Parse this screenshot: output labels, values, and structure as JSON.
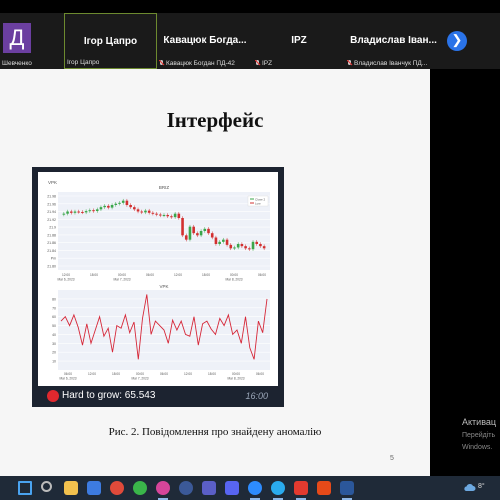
{
  "participants": [
    {
      "name": "Д",
      "label": "Шевченко",
      "muted": false
    },
    {
      "name": "Ігор Цапро",
      "label": "Ігор Цапро",
      "muted": false
    },
    {
      "name": "Кавацюк  Богда...",
      "label": "Кавацюк Богдан ПД-42",
      "muted": true
    },
    {
      "name": "IPZ",
      "label": "IPZ",
      "muted": true
    },
    {
      "name": "Владислав Іван...",
      "label": "Владислав Іванчук ПД...",
      "muted": true
    }
  ],
  "next_icon": "chevron-right-icon",
  "slide": {
    "title": "Інтерфейс",
    "caption": "Рис. 2. Повідомлення про знайдену аномалію",
    "page_number": "5"
  },
  "message": {
    "alert_text": "Hard to grow: 65.543",
    "time": "16:00",
    "dot_color": "#e0282e"
  },
  "chart_data": [
    {
      "type": "candlestick",
      "corner_label": "VPK",
      "title": "BRIZ",
      "legend": [
        "Close 2",
        "Low"
      ],
      "ylim": [
        21.8,
        21.98
      ],
      "y_ticks": [
        "21.98",
        "21.96",
        "21.94",
        "21.92",
        "21.9",
        "21.88",
        "21.86",
        "21.84",
        "Pm",
        "21.80"
      ],
      "x_ticks": [
        "12:00\nMar 6, 2023",
        "18:00",
        "00:00\nMar 7, 2023",
        "06:00",
        "12:00",
        "18:00",
        "00:00\nMar 8, 2023",
        "06:00"
      ],
      "closes": [
        21.93,
        21.935,
        21.932,
        21.935,
        21.934,
        21.933,
        21.936,
        21.938,
        21.936,
        21.94,
        21.945,
        21.948,
        21.944,
        21.95,
        21.953,
        21.955,
        21.96,
        21.95,
        21.945,
        21.94,
        21.935,
        21.933,
        21.937,
        21.932,
        21.93,
        21.928,
        21.926,
        21.927,
        21.924,
        21.922,
        21.93,
        21.92,
        21.88,
        21.87,
        21.9,
        21.885,
        21.88,
        21.89,
        21.895,
        21.885,
        21.875,
        21.86,
        21.865,
        21.87,
        21.858,
        21.85,
        21.852,
        21.86,
        21.855,
        21.85,
        21.848,
        21.865,
        21.86,
        21.855,
        21.85
      ]
    },
    {
      "type": "line",
      "corner_label": "VPK",
      "ylim": [
        0,
        90
      ],
      "y_ticks": [
        "80",
        "70",
        "60",
        "50",
        "40",
        "30",
        "20",
        "10"
      ],
      "x_ticks": [
        "06:00\nMar 6, 2023",
        "12:00",
        "18:00",
        "00:00\nMar 7, 2023",
        "06:00",
        "12:00",
        "18:00",
        "00:00\nMar 8, 2023",
        "06:00"
      ],
      "values": [
        55,
        60,
        50,
        62,
        48,
        28,
        52,
        30,
        45,
        60,
        38,
        47,
        20,
        50,
        47,
        62,
        42,
        54,
        12,
        58,
        85,
        40,
        55,
        50,
        45,
        30,
        56,
        45,
        55,
        40,
        38,
        60,
        28,
        52,
        55,
        46,
        40,
        58,
        50,
        62,
        40,
        45,
        30,
        60,
        25,
        12,
        55,
        42,
        80
      ]
    }
  ],
  "activation": {
    "line1": "Активац",
    "line2": "Перейдіть",
    "line3": "Windows."
  },
  "taskbar": {
    "icons": [
      "windows-start-icon",
      "search-icon",
      "file-explorer-icon",
      "store-icon",
      "chrome-icon",
      "chrome-alt-icon",
      "instagram-icon",
      "facebook-icon",
      "teams-icon",
      "discord-icon",
      "zoom-icon",
      "telegram-icon",
      "pdf-reader-icon",
      "antivirus-icon",
      "word-icon"
    ],
    "temperature": "8°"
  }
}
